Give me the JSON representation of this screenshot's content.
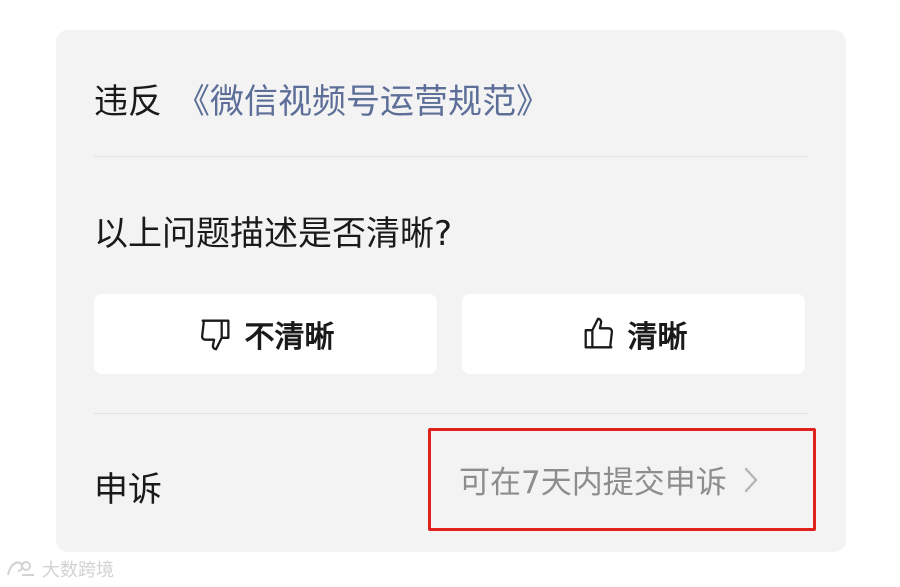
{
  "violation": {
    "prefix": "违反",
    "rule_link": "《微信视频号运营规范》"
  },
  "feedback": {
    "question": "以上问题描述是否清晰?",
    "unclear_label": "不清晰",
    "clear_label": "清晰"
  },
  "appeal": {
    "label": "申诉",
    "hint": "可在7天内提交申诉"
  },
  "watermark": {
    "text": "大数跨境"
  },
  "colors": {
    "card_bg": "#f3f3f3",
    "link": "#5d6f98",
    "highlight_border": "#e0201c",
    "hint_text": "#8d8d8d"
  }
}
